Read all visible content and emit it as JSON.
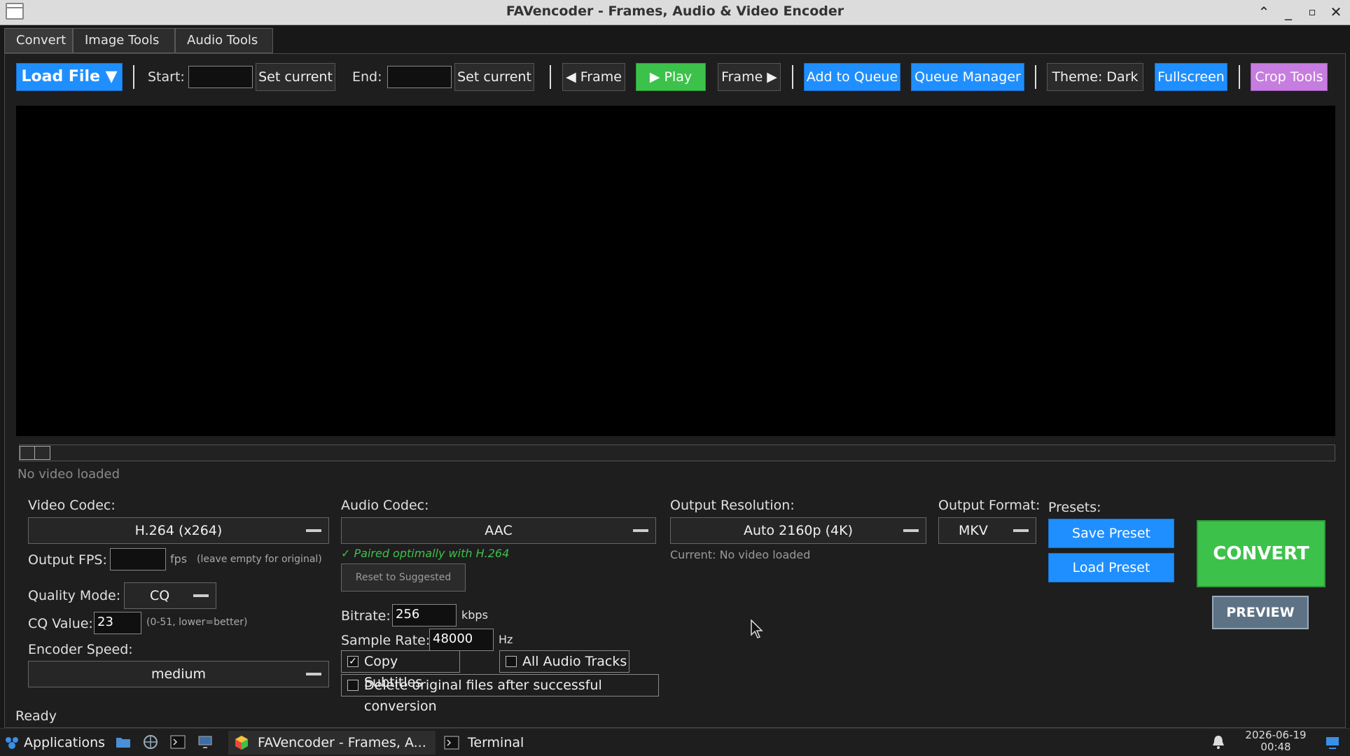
{
  "window": {
    "title": "FAVencoder - Frames, Audio & Video Encoder"
  },
  "tabs": [
    "Convert",
    "Image Tools",
    "Audio Tools"
  ],
  "toolbar": {
    "load_file": "Load File ▼",
    "start_label": "Start:",
    "start_value": "",
    "set_current_start": "Set current",
    "end_label": "End:",
    "end_value": "",
    "set_current_end": "Set current",
    "prev_frame": "◀ Frame",
    "play": "▶ Play",
    "next_frame": "Frame ▶",
    "add_queue": "Add to Queue",
    "queue_manager": "Queue Manager",
    "theme": "Theme: Dark",
    "fullscreen": "Fullscreen",
    "crop_tools": "Crop Tools"
  },
  "player": {
    "status": "No video loaded",
    "seek_position": 0
  },
  "video": {
    "codec_label": "Video Codec:",
    "codec_value": "H.264 (x264)",
    "fps_label": "Output FPS:",
    "fps_value": "",
    "fps_unit": "fps",
    "fps_hint": "(leave empty for original)",
    "quality_label": "Quality Mode:",
    "quality_value": "CQ",
    "cq_label": "CQ Value:",
    "cq_value": "23",
    "cq_hint": "(0-51, lower=better)",
    "speed_label": "Encoder Speed:",
    "speed_value": "medium"
  },
  "audio": {
    "codec_label": "Audio Codec:",
    "codec_value": "AAC",
    "paired_note": "✓ Paired optimally with H.264",
    "reset_button": "Reset to Suggested",
    "bitrate_label": "Bitrate:",
    "bitrate_value": "256",
    "bitrate_unit": "kbps",
    "sample_rate_label": "Sample Rate:",
    "sample_rate_value": "48000",
    "sample_rate_unit": "Hz",
    "copy_subtitles": "Copy Subtitles",
    "copy_subtitles_checked": true,
    "all_audio_tracks": "All Audio Tracks",
    "all_audio_tracks_checked": false,
    "delete_original": "Delete original files after successful conversion",
    "delete_original_checked": false
  },
  "output": {
    "resolution_label": "Output Resolution:",
    "resolution_value": "Auto 2160p (4K)",
    "current_note": "Current: No video loaded",
    "format_label": "Output Format:",
    "format_value": "MKV"
  },
  "presets": {
    "label": "Presets:",
    "save": "Save Preset",
    "load": "Load Preset"
  },
  "actions": {
    "convert": "CONVERT",
    "preview": "PREVIEW"
  },
  "status": "Ready",
  "taskbar": {
    "applications": "Applications",
    "task_favencoder": "FAVencoder - Frames, A...",
    "task_terminal": "Terminal",
    "date": "2026-06-19",
    "time": "00:48"
  },
  "colors": {
    "accent_blue": "#1f8fff",
    "play_green": "#3cc24a",
    "crop_purple": "#c77ce0",
    "convert_green": "#3cc24a"
  }
}
